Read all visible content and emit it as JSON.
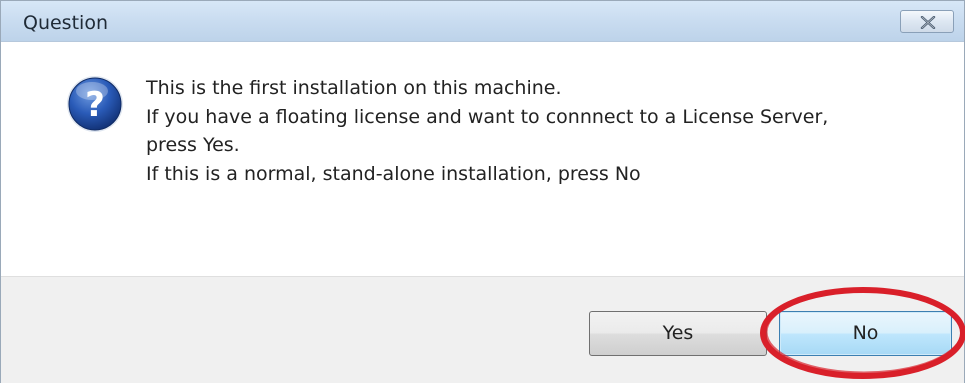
{
  "window": {
    "title": "Question",
    "close_icon": "close-icon"
  },
  "dialog": {
    "icon": "question-icon",
    "message_lines": [
      "This is the first installation on this machine.",
      "If you have a floating license and want to connnect to a License Server,",
      "press Yes.",
      "If this is a normal, stand-alone installation, press No"
    ]
  },
  "buttons": {
    "yes_label": "Yes",
    "no_label": "No"
  },
  "annotation": {
    "highlight_color": "#d9202a",
    "highlighted": "no-button"
  }
}
